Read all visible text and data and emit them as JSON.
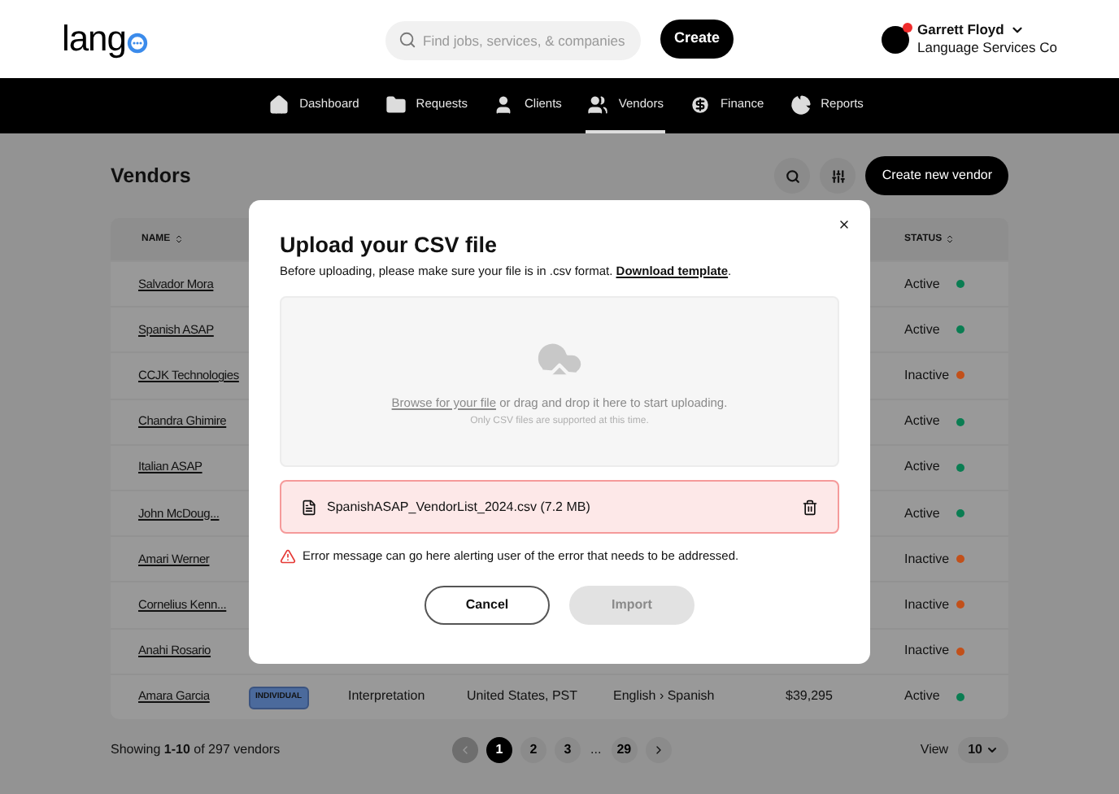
{
  "header": {
    "logo": "lang",
    "search": {
      "placeholder": "Find jobs, services, & companies"
    },
    "create_button": "Create",
    "user": {
      "name": "Garrett Floyd",
      "company": "Language Services Co",
      "notification": true
    }
  },
  "nav": [
    {
      "label": "Dashboard",
      "selected": false
    },
    {
      "label": "Requests",
      "selected": false
    },
    {
      "label": "Clients",
      "selected": false
    },
    {
      "label": "Vendors",
      "selected": true
    },
    {
      "label": "Finance",
      "selected": false
    },
    {
      "label": "Reports",
      "selected": false
    }
  ],
  "page": {
    "title": "Vendors",
    "create_button": "Create new vendor"
  },
  "table": {
    "columns": [
      "NAME",
      "STATUS"
    ],
    "rows": [
      {
        "name": "Salvador Mora",
        "status": "Active",
        "color": "#0a7d52"
      },
      {
        "name": "Spanish ASAP",
        "status": "Active",
        "color": "#0a7d52"
      },
      {
        "name": "CCJK Technologies",
        "status": "Inactive",
        "color": "#c2501a"
      },
      {
        "name": "Chandra Ghimire",
        "status": "Active",
        "color": "#0a7d52"
      },
      {
        "name": "Italian ASAP",
        "status": "Active",
        "color": "#0a7d52"
      },
      {
        "name": "John McDoug...",
        "status": "Active",
        "color": "#0a7d52"
      },
      {
        "name": "Amari Werner",
        "status": "Inactive",
        "color": "#c2501a"
      },
      {
        "name": "Cornelius Kenn...",
        "status": "Inactive",
        "color": "#c2501a"
      },
      {
        "name": "Anahi Rosario",
        "status": "Inactive",
        "color": "#c2501a"
      },
      {
        "name": "Amara Garcia",
        "type": "INDIVIDUAL",
        "service": "Interpretation",
        "location": "United States, PST",
        "languages": "English › Spanish",
        "amount": "$39,295",
        "status": "Active",
        "color": "#0a7d52"
      }
    ]
  },
  "footer": {
    "showing": "Showing **1-10** of 297 vendors",
    "pages": [
      {
        "label": "1",
        "kind": "page",
        "selected": true
      },
      {
        "label": "2",
        "kind": "page",
        "selected": false
      },
      {
        "label": "3",
        "kind": "page",
        "selected": false
      },
      {
        "label": "...",
        "kind": "gap"
      },
      {
        "label": "29",
        "kind": "page",
        "selected": false
      }
    ],
    "prev_disabled": true,
    "view_label": "View",
    "view_value": "10"
  },
  "modal": {
    "title": "Upload your CSV file",
    "intro": "Before uploading, please make sure your file is in .csv format.",
    "intro_link": "Download template",
    "intro_end": ".",
    "browse_link": "Browse for your file",
    "drop_text": "or drag and drop it here to start uploading.",
    "hint": "Only CSV files are supported at this time.",
    "file": {
      "name": "SpanishASAP_VendorList_2024.csv (7.2 MB)",
      "error": true
    },
    "error": "Error message can go here alerting user of the error that needs to be addressed.",
    "cancel": "Cancel",
    "import": {
      "label": "Import",
      "disabled": true
    }
  }
}
